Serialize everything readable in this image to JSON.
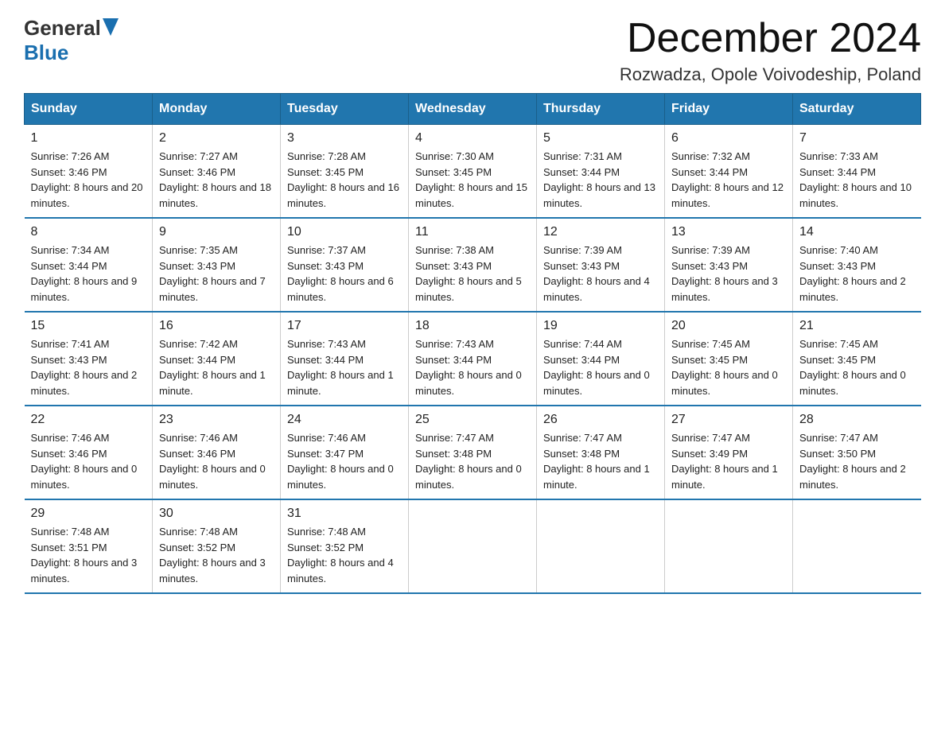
{
  "header": {
    "logo_general": "General",
    "logo_blue": "Blue",
    "month_title": "December 2024",
    "location": "Rozwadza, Opole Voivodeship, Poland"
  },
  "days_of_week": [
    "Sunday",
    "Monday",
    "Tuesday",
    "Wednesday",
    "Thursday",
    "Friday",
    "Saturday"
  ],
  "weeks": [
    [
      {
        "day": "1",
        "sunrise": "7:26 AM",
        "sunset": "3:46 PM",
        "daylight": "8 hours and 20 minutes."
      },
      {
        "day": "2",
        "sunrise": "7:27 AM",
        "sunset": "3:46 PM",
        "daylight": "8 hours and 18 minutes."
      },
      {
        "day": "3",
        "sunrise": "7:28 AM",
        "sunset": "3:45 PM",
        "daylight": "8 hours and 16 minutes."
      },
      {
        "day": "4",
        "sunrise": "7:30 AM",
        "sunset": "3:45 PM",
        "daylight": "8 hours and 15 minutes."
      },
      {
        "day": "5",
        "sunrise": "7:31 AM",
        "sunset": "3:44 PM",
        "daylight": "8 hours and 13 minutes."
      },
      {
        "day": "6",
        "sunrise": "7:32 AM",
        "sunset": "3:44 PM",
        "daylight": "8 hours and 12 minutes."
      },
      {
        "day": "7",
        "sunrise": "7:33 AM",
        "sunset": "3:44 PM",
        "daylight": "8 hours and 10 minutes."
      }
    ],
    [
      {
        "day": "8",
        "sunrise": "7:34 AM",
        "sunset": "3:44 PM",
        "daylight": "8 hours and 9 minutes."
      },
      {
        "day": "9",
        "sunrise": "7:35 AM",
        "sunset": "3:43 PM",
        "daylight": "8 hours and 7 minutes."
      },
      {
        "day": "10",
        "sunrise": "7:37 AM",
        "sunset": "3:43 PM",
        "daylight": "8 hours and 6 minutes."
      },
      {
        "day": "11",
        "sunrise": "7:38 AM",
        "sunset": "3:43 PM",
        "daylight": "8 hours and 5 minutes."
      },
      {
        "day": "12",
        "sunrise": "7:39 AM",
        "sunset": "3:43 PM",
        "daylight": "8 hours and 4 minutes."
      },
      {
        "day": "13",
        "sunrise": "7:39 AM",
        "sunset": "3:43 PM",
        "daylight": "8 hours and 3 minutes."
      },
      {
        "day": "14",
        "sunrise": "7:40 AM",
        "sunset": "3:43 PM",
        "daylight": "8 hours and 2 minutes."
      }
    ],
    [
      {
        "day": "15",
        "sunrise": "7:41 AM",
        "sunset": "3:43 PM",
        "daylight": "8 hours and 2 minutes."
      },
      {
        "day": "16",
        "sunrise": "7:42 AM",
        "sunset": "3:44 PM",
        "daylight": "8 hours and 1 minute."
      },
      {
        "day": "17",
        "sunrise": "7:43 AM",
        "sunset": "3:44 PM",
        "daylight": "8 hours and 1 minute."
      },
      {
        "day": "18",
        "sunrise": "7:43 AM",
        "sunset": "3:44 PM",
        "daylight": "8 hours and 0 minutes."
      },
      {
        "day": "19",
        "sunrise": "7:44 AM",
        "sunset": "3:44 PM",
        "daylight": "8 hours and 0 minutes."
      },
      {
        "day": "20",
        "sunrise": "7:45 AM",
        "sunset": "3:45 PM",
        "daylight": "8 hours and 0 minutes."
      },
      {
        "day": "21",
        "sunrise": "7:45 AM",
        "sunset": "3:45 PM",
        "daylight": "8 hours and 0 minutes."
      }
    ],
    [
      {
        "day": "22",
        "sunrise": "7:46 AM",
        "sunset": "3:46 PM",
        "daylight": "8 hours and 0 minutes."
      },
      {
        "day": "23",
        "sunrise": "7:46 AM",
        "sunset": "3:46 PM",
        "daylight": "8 hours and 0 minutes."
      },
      {
        "day": "24",
        "sunrise": "7:46 AM",
        "sunset": "3:47 PM",
        "daylight": "8 hours and 0 minutes."
      },
      {
        "day": "25",
        "sunrise": "7:47 AM",
        "sunset": "3:48 PM",
        "daylight": "8 hours and 0 minutes."
      },
      {
        "day": "26",
        "sunrise": "7:47 AM",
        "sunset": "3:48 PM",
        "daylight": "8 hours and 1 minute."
      },
      {
        "day": "27",
        "sunrise": "7:47 AM",
        "sunset": "3:49 PM",
        "daylight": "8 hours and 1 minute."
      },
      {
        "day": "28",
        "sunrise": "7:47 AM",
        "sunset": "3:50 PM",
        "daylight": "8 hours and 2 minutes."
      }
    ],
    [
      {
        "day": "29",
        "sunrise": "7:48 AM",
        "sunset": "3:51 PM",
        "daylight": "8 hours and 3 minutes."
      },
      {
        "day": "30",
        "sunrise": "7:48 AM",
        "sunset": "3:52 PM",
        "daylight": "8 hours and 3 minutes."
      },
      {
        "day": "31",
        "sunrise": "7:48 AM",
        "sunset": "3:52 PM",
        "daylight": "8 hours and 4 minutes."
      },
      null,
      null,
      null,
      null
    ]
  ]
}
